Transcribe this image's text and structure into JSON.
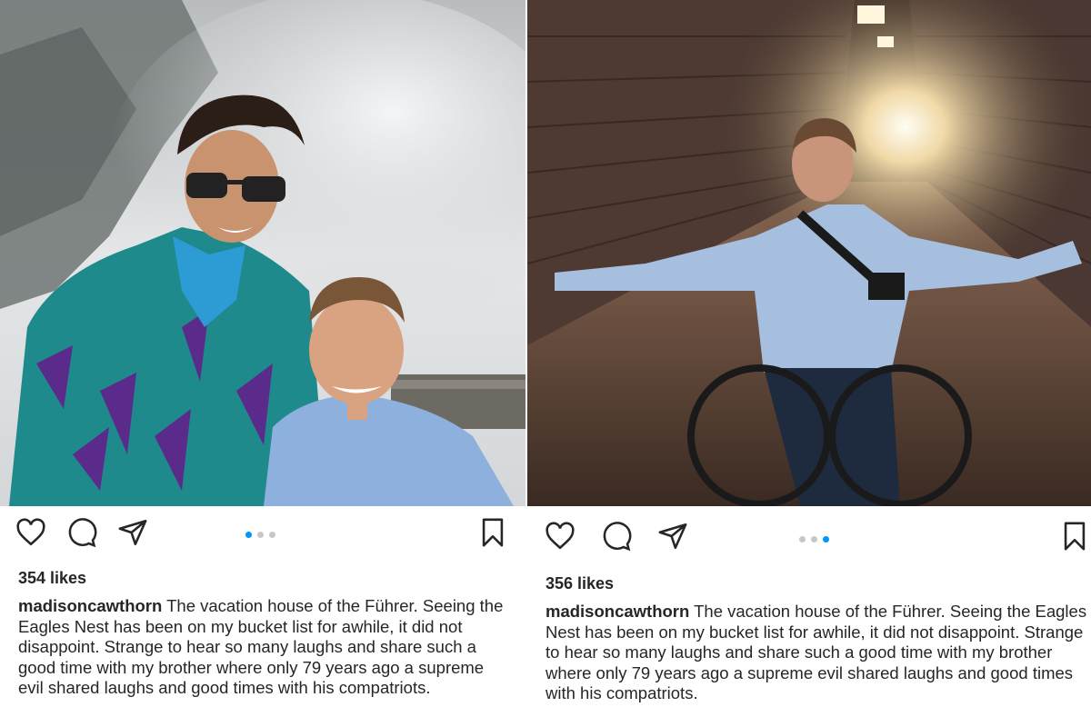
{
  "posts": [
    {
      "likes": "354 likes",
      "username": "madisoncawthorn",
      "caption": "The vacation house of the Führer. Seeing the Eagles Nest has been on my bucket list for awhile, it did not disappoint. Strange to hear so many laughs and share such a good time with my brother where only 79 years ago a supreme evil shared laughs and good times with his compatriots.",
      "carousel": {
        "count": 3,
        "active": 1
      },
      "icons": [
        "heart-icon",
        "comment-icon",
        "share-icon",
        "bookmark-icon"
      ]
    },
    {
      "likes": "356 likes",
      "username": "madisoncawthorn",
      "caption": "The vacation house of the Führer. Seeing the Eagles Nest has been on my bucket list for awhile, it did not disappoint. Strange to hear so many laughs and share such a good time with my brother where only 79 years ago a supreme evil shared laughs and good times with his compatriots.",
      "carousel": {
        "count": 3,
        "active": 3
      },
      "icons": [
        "heart-icon",
        "comment-icon",
        "share-icon",
        "bookmark-icon"
      ]
    }
  ],
  "colors": {
    "text": "#262626",
    "accent": "#0095f6",
    "inactive_dot": "#c7c7c7"
  }
}
